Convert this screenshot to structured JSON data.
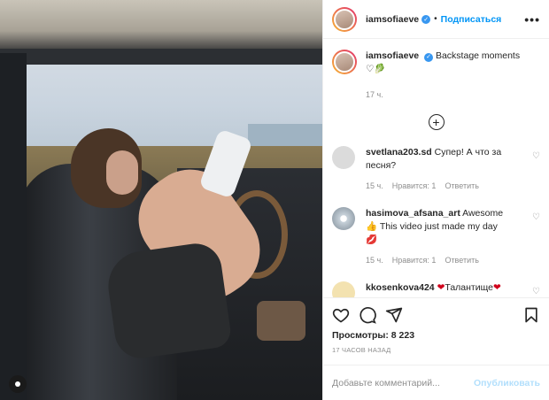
{
  "header": {
    "username": "iamsofiaeve",
    "verified_icon": "verified-badge-icon",
    "separator": "•",
    "follow_label": "Подписаться",
    "more_label": "•••"
  },
  "caption": {
    "username": "iamsofiaeve",
    "text": "Backstage moments",
    "emoji": "♡🥬",
    "time": "17 ч."
  },
  "load_more_icon": "plus-circle-icon",
  "comments": [
    {
      "username": "svetlana203.sd",
      "text": "Супер! А что за песня?",
      "time": "15 ч.",
      "likes": "Нравится: 1",
      "reply": "Ответить"
    },
    {
      "username": "hasimova_afsana_art",
      "text_pre": "Awesome",
      "emoji1": "👍",
      "text_post": "This video just made my day",
      "emoji2": "💋",
      "time": "15 ч.",
      "likes": "Нравится: 1",
      "reply": "Ответить"
    },
    {
      "username": "kkosenkova424",
      "emoji_a": "❤",
      "text": "Талантище",
      "emoji_b": "❤"
    }
  ],
  "actions": {
    "icons": [
      "heart-icon",
      "comment-icon",
      "share-icon",
      "bookmark-icon"
    ],
    "views": "Просмотры: 8 223",
    "ago": "17 ЧАСОВ НАЗАД"
  },
  "add_comment": {
    "placeholder": "Добавьте комментарий...",
    "publish_label": "Опубликовать"
  },
  "colors": {
    "accent": "#0095f6",
    "publish_disabled": "#b2dffc",
    "muted": "#8e8e8e"
  }
}
